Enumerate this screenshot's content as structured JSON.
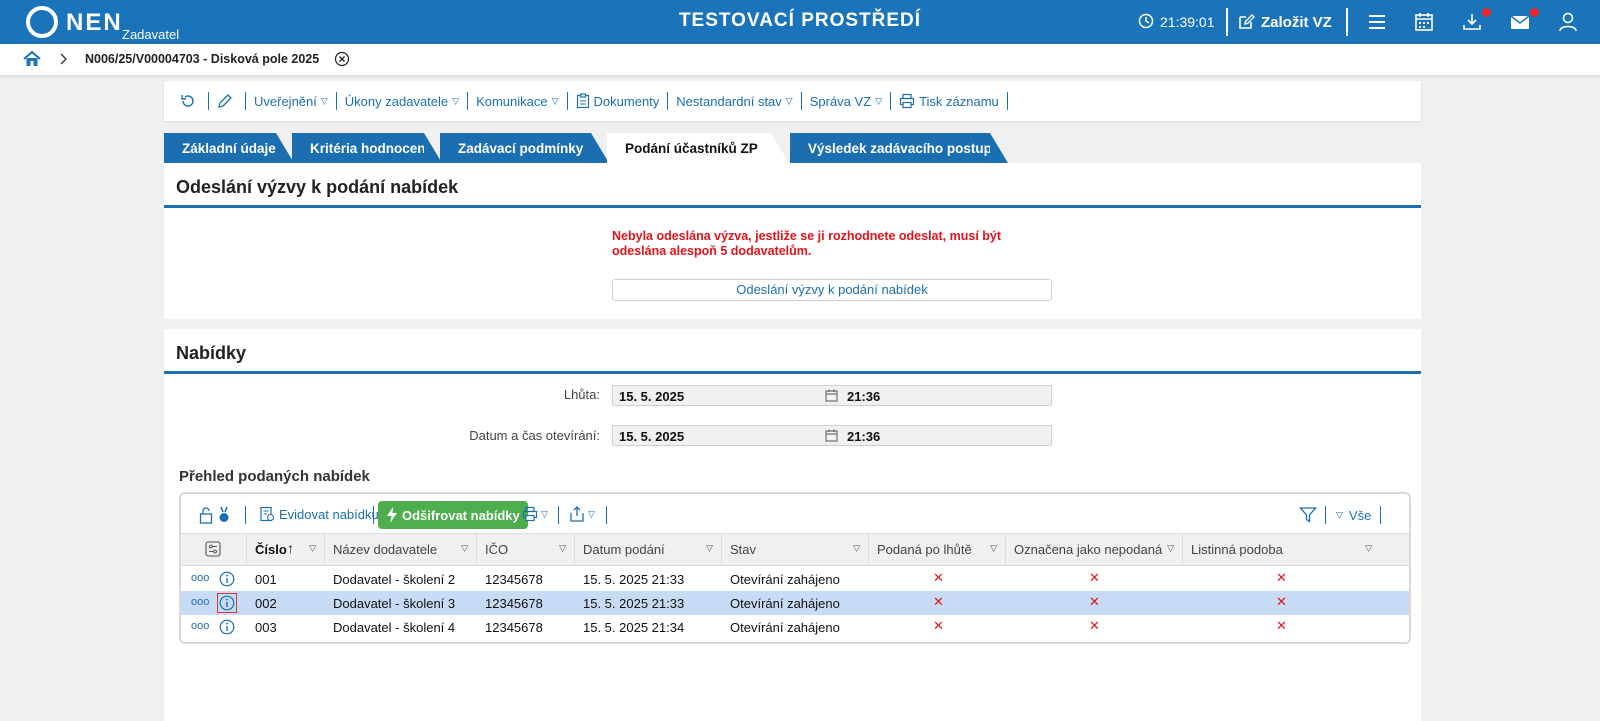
{
  "topbar": {
    "logo_text": "NEN",
    "logo_sub": "Zadavatel",
    "env_title": "TESTOVACÍ PROSTŘEDÍ",
    "clock": "21:39:01",
    "new_vz_label": "Založit VZ",
    "icons": [
      "menu-icon",
      "calendar-icon",
      "download-icon",
      "mail-icon",
      "user-icon"
    ],
    "accent": "#1b74b9",
    "notif_color": "#e5252a"
  },
  "breadcrumb": {
    "title": "N006/25/V00004703 - Disková pole 2025"
  },
  "toolbar": {
    "items": [
      {
        "label": "Uveřejnění"
      },
      {
        "label": "Úkony zadavatele"
      },
      {
        "label": "Komunikace"
      },
      {
        "label": "Dokumenty"
      },
      {
        "label": "Nestandardní stav"
      },
      {
        "label": "Správa VZ"
      },
      {
        "label": "Tisk záznamu"
      }
    ]
  },
  "tabs": [
    {
      "label": "Základní údaje"
    },
    {
      "label": "Kritéria hodnocení"
    },
    {
      "label": "Zadávací podmínky"
    },
    {
      "label": "Podání účastníků ZP"
    },
    {
      "label": "Výsledek zadávacího postupu"
    }
  ],
  "invite_section": {
    "title": "Odeslání výzvy k podání nabídek",
    "warning": "Nebyla odeslána výzva, jestliže se ji rozhodnete odeslat, musí být odeslána alespoň 5 dodavatelům.",
    "button_label": "Odeslání výzvy k podání nabídek"
  },
  "offers_section": {
    "title": "Nabídky",
    "deadline_label": "Lhůta:",
    "deadline_date": "15. 5. 2025",
    "deadline_time": "21:36",
    "opening_label": "Datum a čas otevírání:",
    "opening_date": "15. 5. 2025",
    "opening_time": "21:36",
    "grid_title": "Přehled podaných nabídek",
    "register_label": "Evidovat nabídku",
    "decrypt_label": "Odšifrovat nabídky",
    "filter_all_label": "Vše",
    "columns": [
      "Číslo",
      "Název dodavatele",
      "IČO",
      "Datum podání",
      "Stav",
      "Podaná po lhůtě",
      "Označena jako nepodaná",
      "Listinná podoba"
    ],
    "rows": [
      {
        "number": "001",
        "supplier": "Dodavatel - školení 2",
        "ico": "12345678",
        "submitted": "15. 5. 2025 21:33",
        "status": "Otevírání zahájeno",
        "late": "✕",
        "marked": "✕",
        "paper": "✕"
      },
      {
        "number": "002",
        "supplier": "Dodavatel - školení 3",
        "ico": "12345678",
        "submitted": "15. 5. 2025 21:33",
        "status": "Otevírání zahájeno",
        "late": "✕",
        "marked": "✕",
        "paper": "✕"
      },
      {
        "number": "003",
        "supplier": "Dodavatel - školení 4",
        "ico": "12345678",
        "submitted": "15. 5. 2025 21:34",
        "status": "Otevírání zahájeno",
        "late": "✕",
        "marked": "✕",
        "paper": "✕"
      }
    ]
  }
}
